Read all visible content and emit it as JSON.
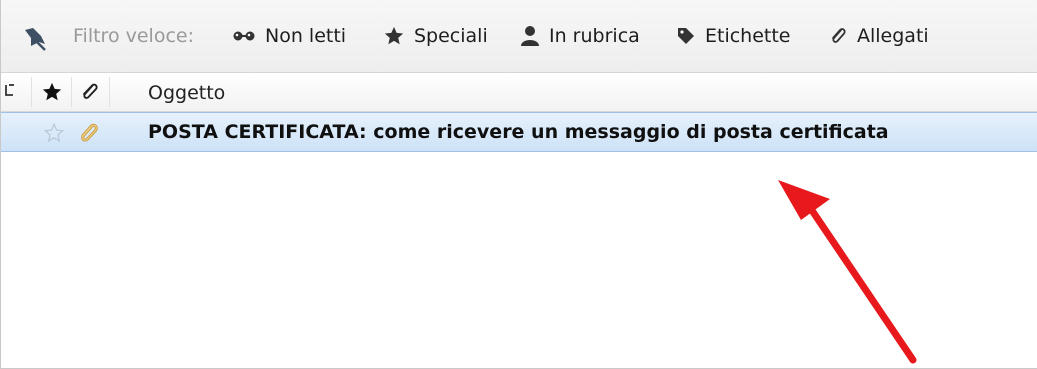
{
  "quick_filter": {
    "label": "Filtro veloce:",
    "pin_icon": "pin-icon",
    "buttons": [
      {
        "label": "Non letti",
        "icon": "glasses-icon"
      },
      {
        "label": "Speciali",
        "icon": "star-icon"
      },
      {
        "label": "In rubrica",
        "icon": "contact-icon"
      },
      {
        "label": "Etichette",
        "icon": "tag-icon"
      },
      {
        "label": "Allegati",
        "icon": "paperclip-icon"
      }
    ]
  },
  "columns": {
    "thread_icon": "thread-icon",
    "star_icon": "star-icon",
    "attachment_icon": "paperclip-icon",
    "subject": "Oggetto"
  },
  "messages": [
    {
      "starred": false,
      "has_attachment": true,
      "selected": true,
      "subject": "POSTA CERTIFICATA: come ricevere un messaggio di posta certificata"
    }
  ],
  "colors": {
    "selection": "#cde2f7",
    "annotation_arrow": "#e8191c",
    "attachment": "#c89a3a"
  }
}
